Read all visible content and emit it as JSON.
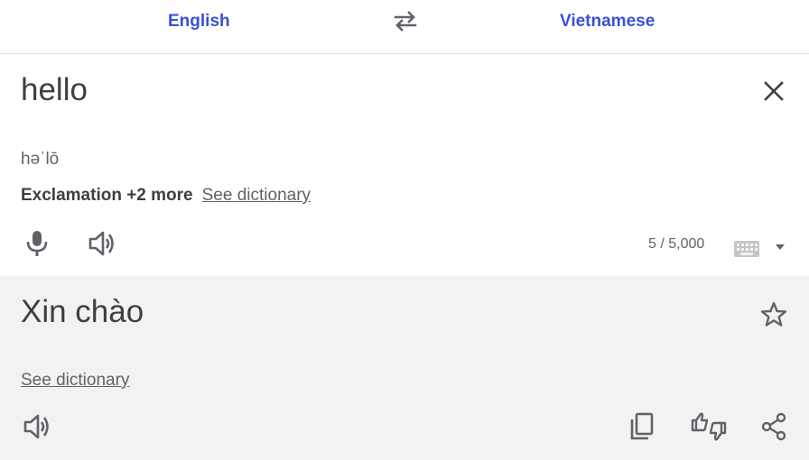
{
  "languages": {
    "source": "English",
    "target": "Vietnamese"
  },
  "source": {
    "text": "hello",
    "phonetic": "həˈlō",
    "part_of_speech": "Exclamation +2 more",
    "see_dictionary": "See dictionary",
    "char_count": "5 / 5,000"
  },
  "target": {
    "text": "Xin chào",
    "see_dictionary": "See dictionary"
  },
  "icons": {
    "swap": "swap-languages-icon",
    "clear": "close-icon",
    "mic": "microphone-icon",
    "listen": "speaker-icon",
    "keyboard": "keyboard-icon",
    "dropdown": "caret-down-icon",
    "save": "star-icon",
    "copy": "copy-icon",
    "feedback": "feedback-thumbs-icon",
    "share": "share-icon"
  },
  "colors": {
    "accent": "#3b4fd8",
    "text": "#3c4043",
    "icon": "#5f6368",
    "target_bg": "#f2f2f2"
  }
}
